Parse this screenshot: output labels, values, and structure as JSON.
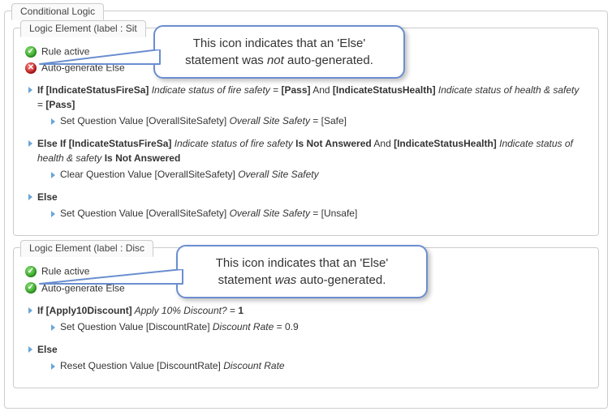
{
  "header": {
    "tab_label": "Conditional Logic"
  },
  "callouts": {
    "c1_line1": "This icon indicates that an 'Else'",
    "c1_line2_a": "statement was ",
    "c1_line2_b": "not",
    "c1_line2_c": " auto-generated.",
    "c2_line1": "This icon indicates that an 'Else'",
    "c2_line2_a": "statement ",
    "c2_line2_b": "was",
    "c2_line2_c": " auto-generated."
  },
  "panel1": {
    "tab_label": "Logic Element (label : Sit",
    "rule_active_label": "Rule active",
    "autogen_label": "Auto-generate Else",
    "autogen_state": false,
    "if_head_parts": {
      "p1": "If ",
      "p2": "[IndicateStatusFireSa]",
      "p3": " Indicate status of fire safety",
      "p4": " = ",
      "p5": "[Pass]",
      "p6": " And ",
      "p7": "[IndicateStatusHealth]",
      "p8": " Indicate status of health & safety",
      "p9": " = ",
      "p10": "[Pass]"
    },
    "if_body": {
      "b1": "Set Question Value [OverallSiteSafety] ",
      "b2": "Overall Site Safety",
      "b3": " = [Safe]"
    },
    "elseif_head_parts": {
      "p1": "Else If ",
      "p2": "[IndicateStatusFireSa]",
      "p3": " Indicate status of fire safety",
      "p4": " Is Not Answered",
      "p5": " And ",
      "p6": "[IndicateStatusHealth]",
      "p7": " Indicate status of health & safety",
      "p8": " Is Not Answered"
    },
    "elseif_body": {
      "b1": "Clear Question Value [OverallSiteSafety] ",
      "b2": "Overall Site Safety"
    },
    "else_label": "Else",
    "else_body": {
      "b1": "Set Question Value [OverallSiteSafety] ",
      "b2": "Overall Site Safety",
      "b3": " = [Unsafe]"
    }
  },
  "panel2": {
    "tab_label": "Logic Element (label : Disc",
    "rule_active_label": "Rule active",
    "autogen_label": "Auto-generate Else",
    "autogen_state": true,
    "if_head_parts": {
      "p1": "If ",
      "p2": "[Apply10Discount]",
      "p3": " Apply 10% Discount?",
      "p4": " = ",
      "p5": "1"
    },
    "if_body": {
      "b1": "Set Question Value [DiscountRate] ",
      "b2": "Discount Rate",
      "b3": " = 0.9"
    },
    "else_label": "Else",
    "else_body": {
      "b1": "Reset Question Value [DiscountRate] ",
      "b2": "Discount Rate"
    }
  }
}
